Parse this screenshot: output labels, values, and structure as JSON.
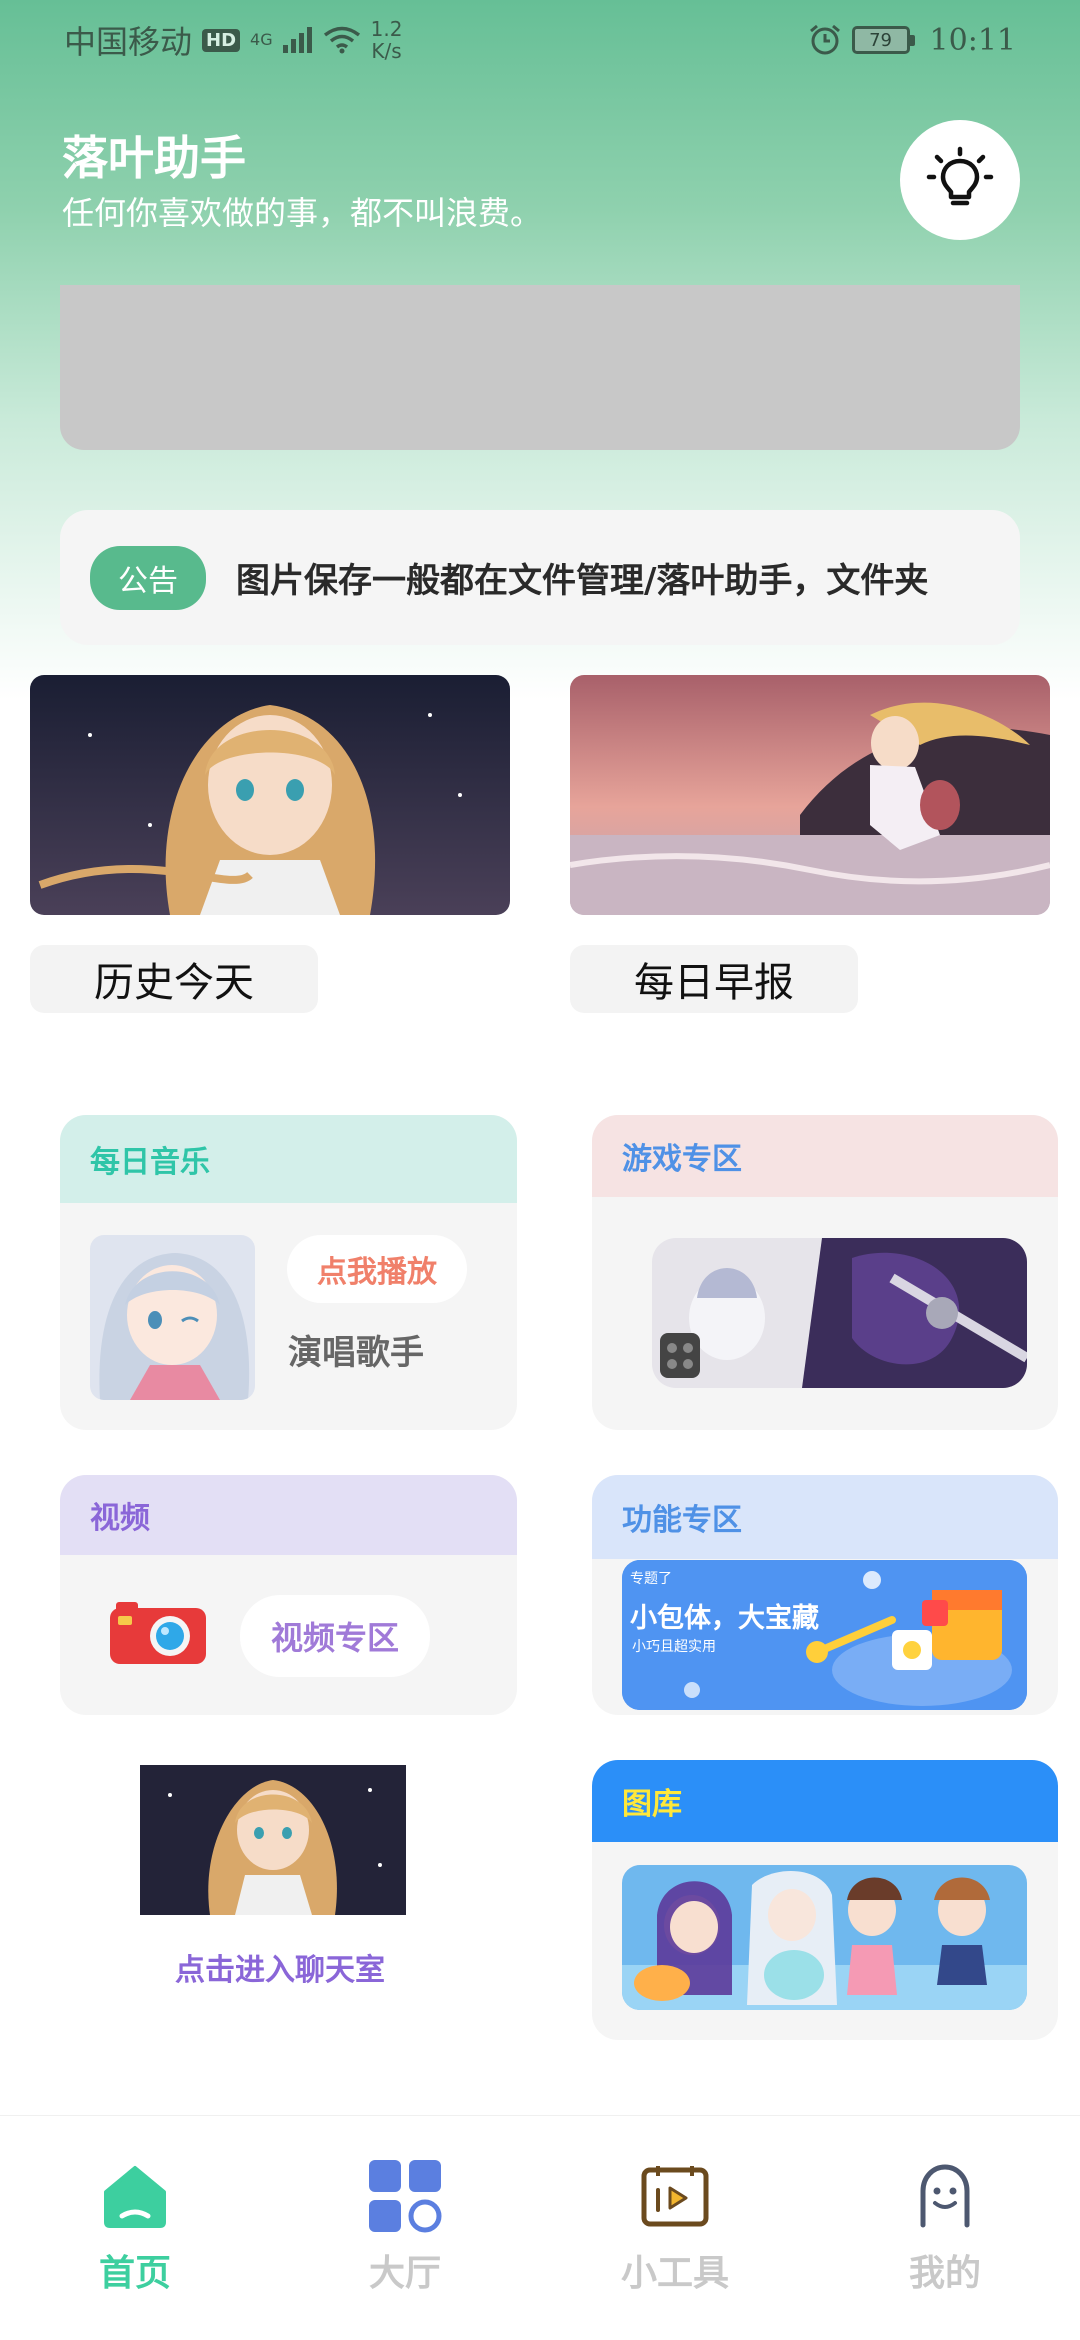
{
  "status_bar": {
    "carrier": "中国移动",
    "hd": "HD",
    "network": "4G",
    "speed_value": "1.2",
    "speed_unit": "K/s",
    "battery": "79",
    "time": "10:11"
  },
  "header": {
    "title": "落叶助手",
    "subtitle": "任何你喜欢做的事，都不叫浪费。",
    "bulb_icon": "lightbulb-icon"
  },
  "notice": {
    "tag": "公告",
    "text": "图片保存一般都在文件管理/落叶助手，文件夹"
  },
  "tiles": [
    {
      "label": "历史今天"
    },
    {
      "label": "每日早报"
    }
  ],
  "cards": {
    "music": {
      "title": "每日音乐",
      "play": "点我播放",
      "singer": "演唱歌手"
    },
    "game": {
      "title": "游戏专区"
    },
    "video": {
      "title": "视频",
      "button": "视频专区"
    },
    "feature": {
      "title": "功能专区",
      "banner_title": "小包体，大宝藏",
      "banner_sub": "小巧且超实用",
      "banner_brand": "专题了"
    },
    "chat": {
      "label": "点击进入聊天室"
    },
    "gallery": {
      "title": "图库"
    }
  },
  "colors": {
    "accent_green": "#58ba8d",
    "music_head": "#d3efea",
    "game_head": "#f6e3e3",
    "video_head": "#e3dff5",
    "feature_head": "#d9e5fa",
    "gallery_head": "#2b8ff8",
    "nav_active": "#3dcf9f"
  },
  "nav": [
    {
      "label": "首页",
      "icon": "home-icon"
    },
    {
      "label": "大厅",
      "icon": "grid-icon"
    },
    {
      "label": "小工具",
      "icon": "video-play-icon"
    },
    {
      "label": "我的",
      "icon": "profile-icon"
    }
  ]
}
